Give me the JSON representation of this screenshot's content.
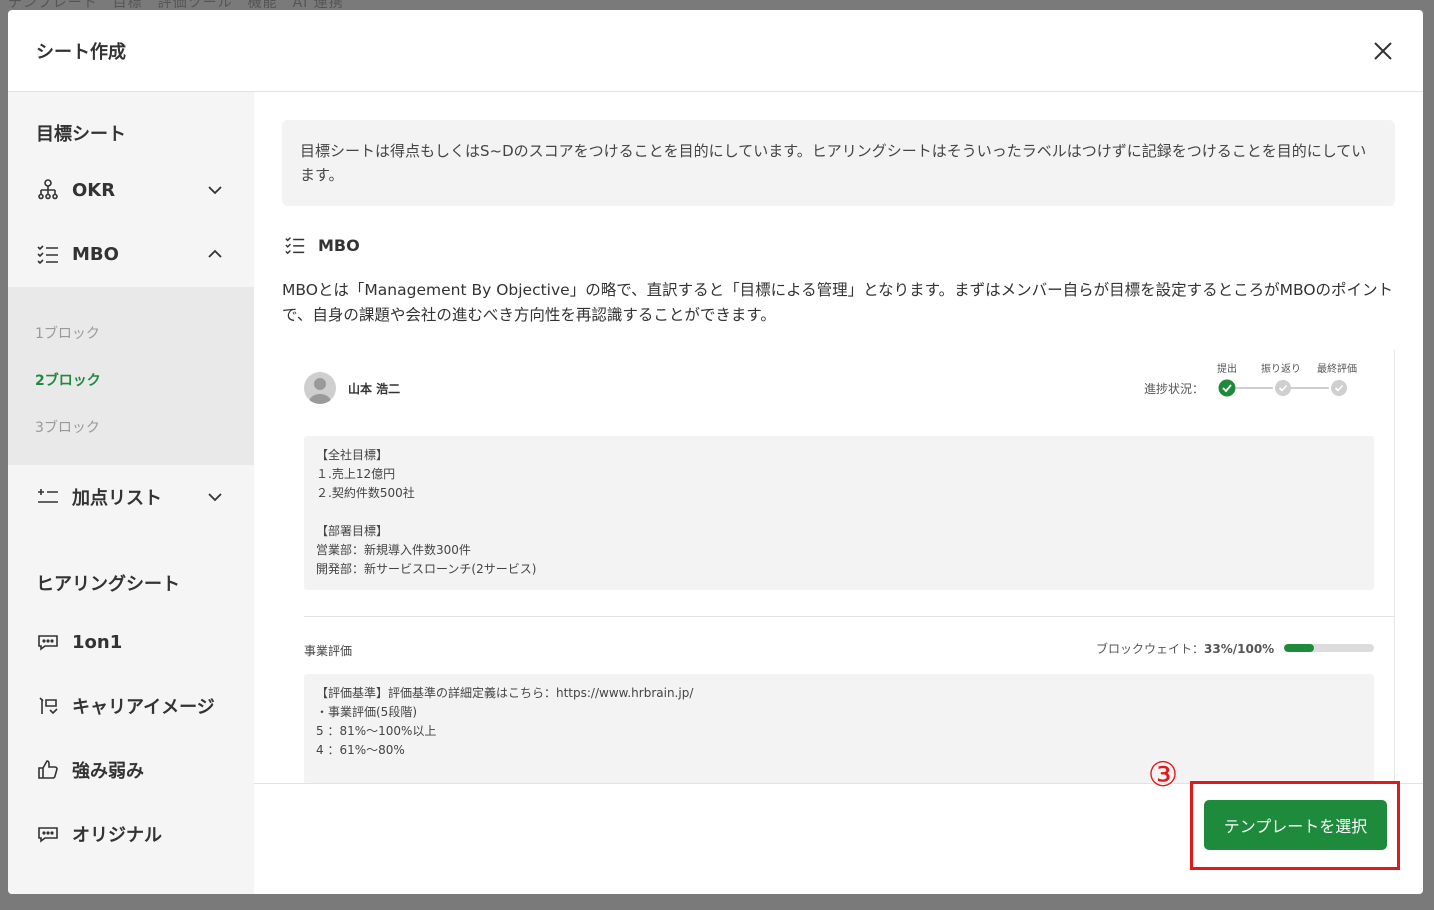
{
  "backdrop_text": "テンプレート　目標　評価ツール　機能　AI 連携",
  "modal": {
    "title": "シート作成"
  },
  "sidebar": {
    "goal_heading": "目標シート",
    "okr_label": "OKR",
    "mbo_label": "MBO",
    "sub_items": [
      "1ブロック",
      "2ブロック",
      "3ブロック"
    ],
    "active_sub": "2ブロック",
    "points_label": "加点リスト",
    "hearing_heading": "ヒアリングシート",
    "hearing_items": [
      "1on1",
      "キャリアイメージ",
      "強み弱み",
      "オリジナル"
    ]
  },
  "content": {
    "note": "目標シートは得点もしくはS~Dのスコアをつけることを目的にしています。ヒアリングシートはそういったラベルはつけずに記録をつけることを目的にしています。",
    "section_title": "MBO",
    "description": "MBOとは「Management By Objective」の略で、直訳すると「目標による管理」となります。まずはメンバー自らが目標を設定するところがMBOのポイントで、自身の課題や会社の進むべき方向性を再認識することができます。",
    "preview": {
      "user_name": "山本 浩二",
      "progress_label": "進捗状況：",
      "steps": [
        "提出",
        "振り返り",
        "最終評価"
      ],
      "current_step": 1,
      "goals_text": "【全社目標】\n１.売上12億円\n２.契約件数500社\n\n【部署目標】\n営業部：新規導入件数300件\n開発部：新サービスローンチ(2サービス)",
      "eval_label": "事業評価",
      "weight_label": "ブロックウェイト：",
      "weight_value": "33%/100%",
      "weight_fraction": 0.33,
      "criteria_text": "【評価基準】評価基準の詳細定義はこちら：https://www.hrbrain.jp/\n・事業評価(5段階)\n5 ：81%〜100%以上\n4 ：61%〜80%"
    }
  },
  "footer": {
    "select_button": "テンプレートを選択",
    "annotation_number": "③"
  },
  "colors": {
    "accent": "#1e8a3c",
    "annotation": "#e0191b"
  }
}
